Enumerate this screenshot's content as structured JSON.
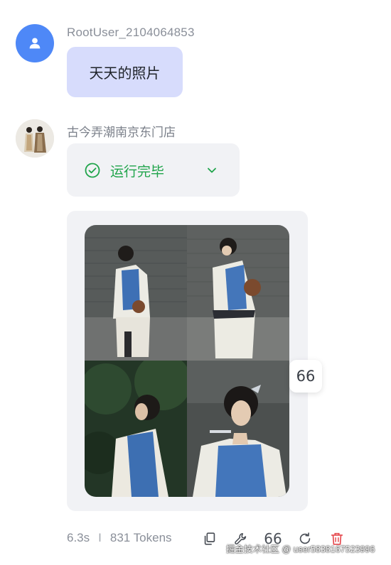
{
  "user_message": {
    "username": "RootUser_2104064853",
    "text": "天天的照片",
    "avatar_icon": "person-icon",
    "avatar_color": "#4e88f7",
    "bubble_color": "#d7dcfc"
  },
  "bot_message": {
    "name": "古今弄潮南京东门店",
    "status": {
      "label": "运行完毕",
      "icon": "check-circle-icon",
      "expand_icon": "chevron-down-icon",
      "color": "#1fa44a"
    },
    "images": [
      {
        "subject": "woman in qing-style robe, back view, holding fan"
      },
      {
        "subject": "woman in qing-style robe, side view, holding fan"
      },
      {
        "subject": "woman in qing-style robe among trees"
      },
      {
        "subject": "woman in qing-style robe with hairpin, close-up"
      }
    ],
    "quote_badge": "66"
  },
  "footer": {
    "duration": "6.3s",
    "separator": "I",
    "tokens": "831 Tokens",
    "actions": [
      {
        "name": "copy-icon"
      },
      {
        "name": "wrench-icon"
      },
      {
        "name": "quote-icon",
        "glyph": "66"
      },
      {
        "name": "refresh-icon"
      },
      {
        "name": "trash-icon",
        "color": "#e5484d"
      }
    ]
  },
  "watermark": "掘金技术社区 @ user5838167523996"
}
